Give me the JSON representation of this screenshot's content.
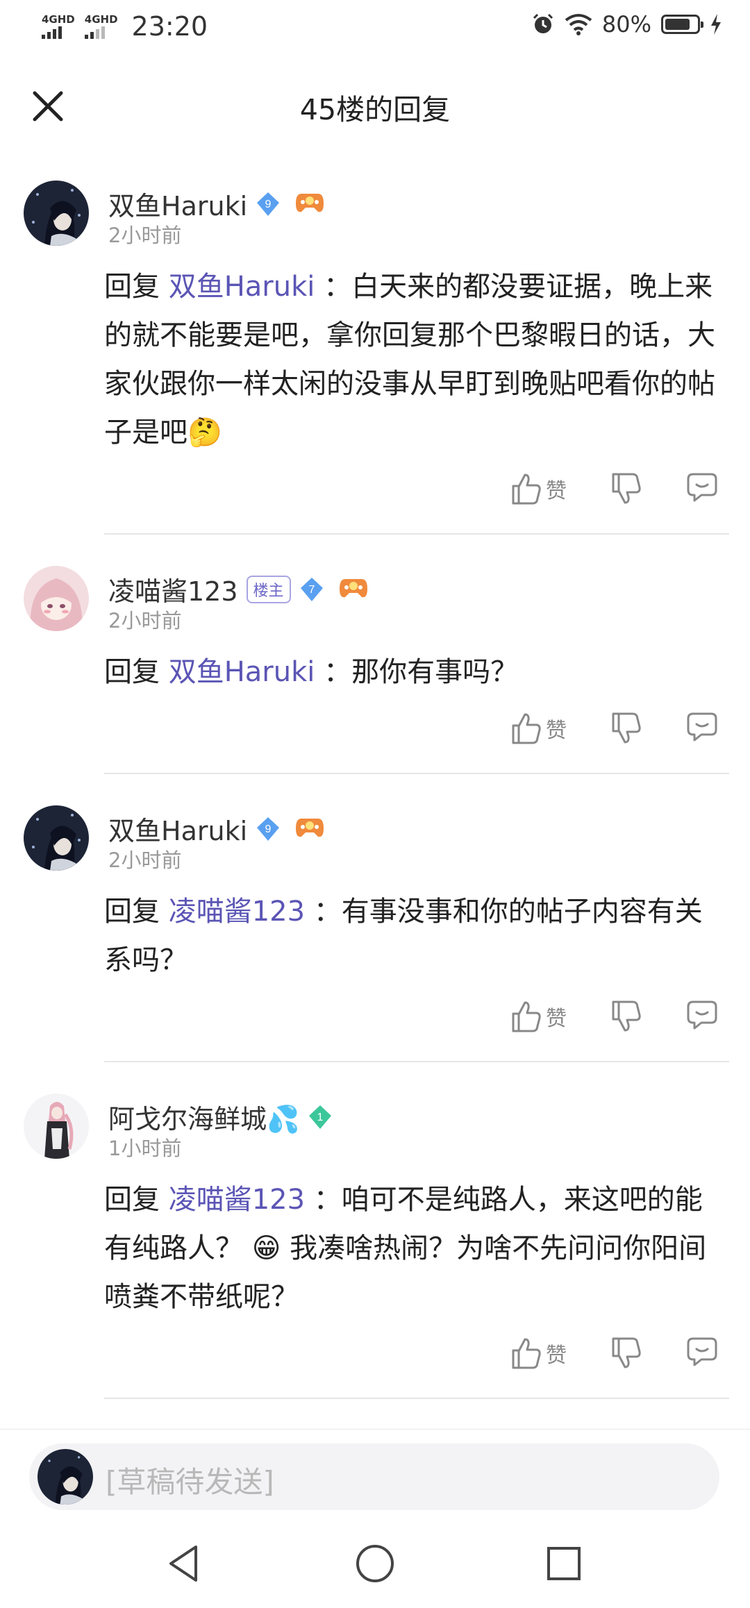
{
  "status_bar": {
    "network_1": "4GHD",
    "network_2": "4GHD",
    "time": "23:20",
    "battery_percent": "80%",
    "battery_level": 0.8
  },
  "header": {
    "title": "45楼的回复",
    "close_icon": "close-icon"
  },
  "comments": [
    {
      "username": "双鱼Haruki",
      "level": "9",
      "time": "2小时前",
      "reply_prefix": "回复",
      "mention": "双鱼Haruki",
      "text": "：白天来的都没要证据，晚上来的就不能要是吧，拿你回复那个巴黎暇日的话，大家伙跟你一样太闲的没事从早盯到晚贴吧看你的帖子是吧",
      "emoji": "🤔",
      "like_label": "赞"
    },
    {
      "username": "凌喵酱123",
      "host_badge": "楼主",
      "level": "7",
      "time": "2小时前",
      "reply_prefix": "回复",
      "mention": "双鱼Haruki",
      "text": "：那你有事吗？",
      "like_label": "赞"
    },
    {
      "username": "双鱼Haruki",
      "level": "9",
      "time": "2小时前",
      "reply_prefix": "回复",
      "mention": "凌喵酱123",
      "text": "：有事没事和你的帖子内容有关系吗？",
      "like_label": "赞"
    },
    {
      "username": "阿戈尔海鲜城💦",
      "level": "1",
      "time": "1小时前",
      "reply_prefix": "回复",
      "mention": "凌喵酱123",
      "text_1": "：咱可不是纯路人，来这吧的能有纯路人？",
      "emoji": "😁",
      "text_2": "我凑啥热闹？为啥不先问问你阳间喷粪不带纸呢？",
      "like_label": "赞"
    }
  ],
  "input": {
    "placeholder": "[草稿待发送]"
  },
  "colors": {
    "mention": "#5b55b5",
    "level_badge": "#5aa0f0",
    "level_badge_green": "#3cc79a",
    "secondary_text": "#999999"
  }
}
